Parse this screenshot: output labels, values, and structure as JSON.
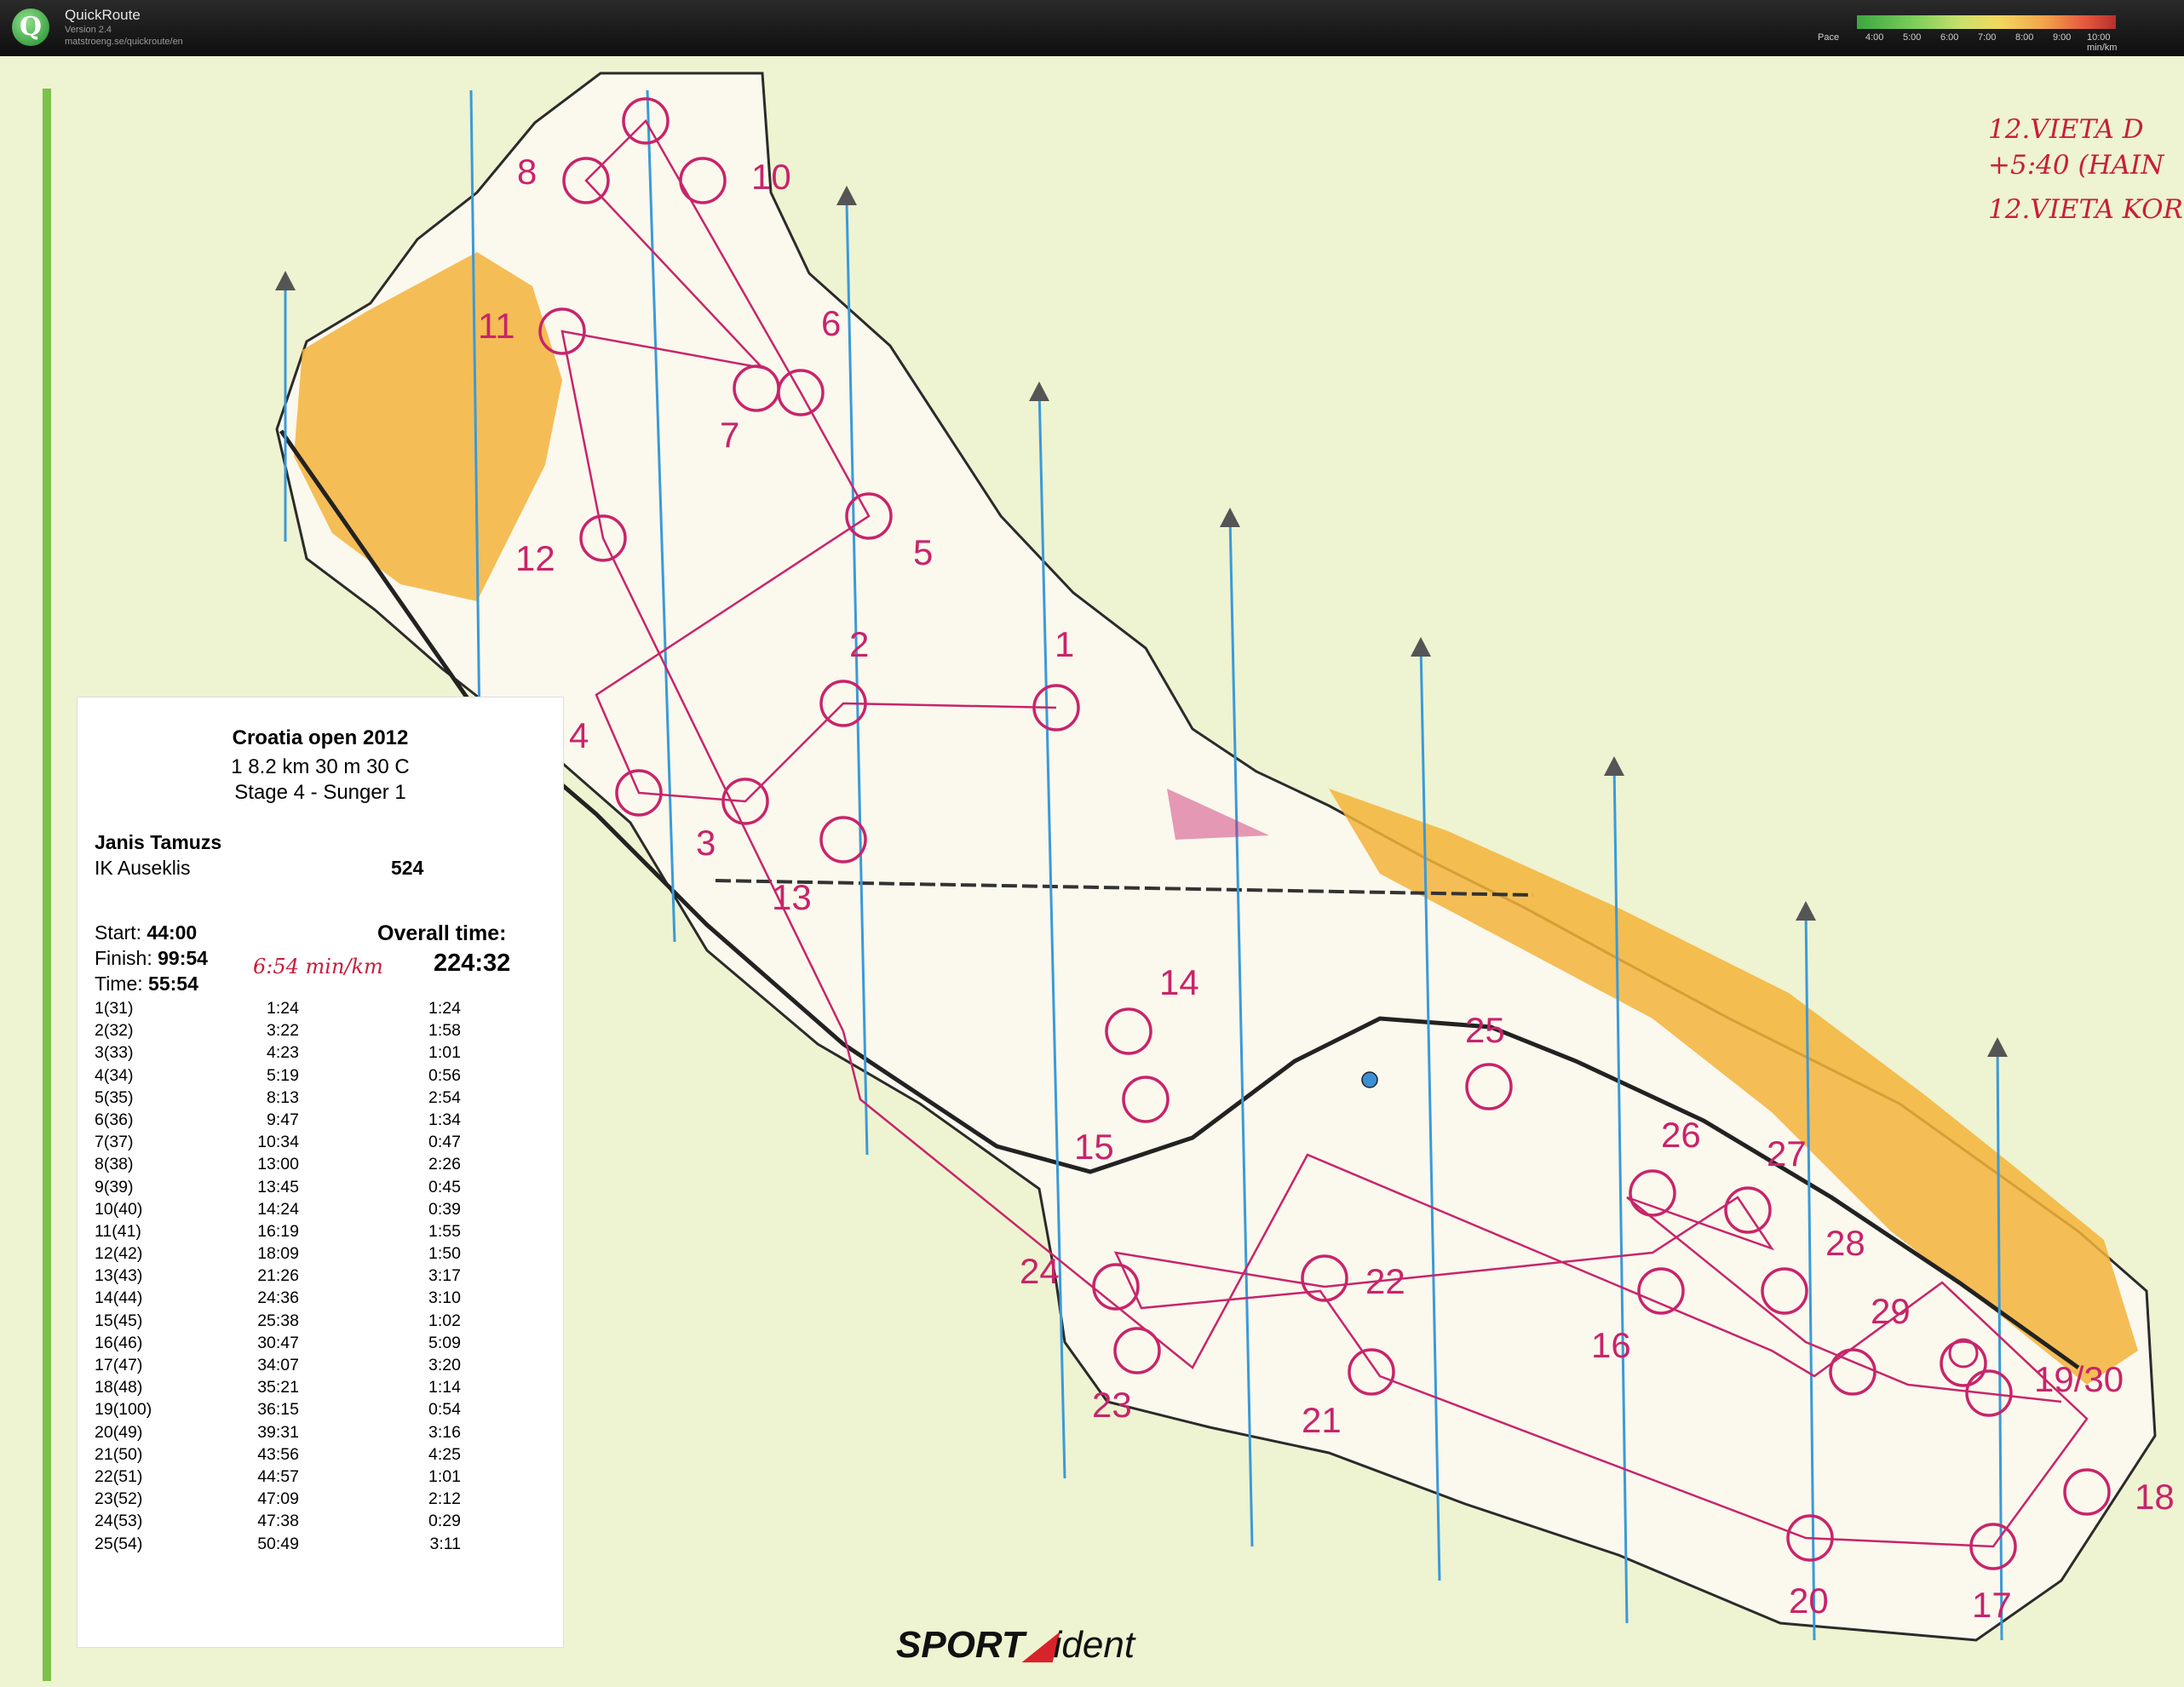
{
  "app": {
    "title": "QuickRoute",
    "version": "Version 2.4",
    "url": "matstroeng.se/quickroute/en",
    "logo_letter": "Q",
    "pace_label": "Pace",
    "pace_ticks": [
      "4:00",
      "5:00",
      "6:00",
      "7:00",
      "8:00",
      "9:00",
      "10:00 min/km"
    ]
  },
  "event": {
    "title": "Croatia open 2012",
    "course": "1  8.2 km  30 m  30 C",
    "stage": "Stage 4 - Sunger 1"
  },
  "runner": {
    "name": "Janis Tamuzs",
    "club": "IK Auseklis",
    "place": "524",
    "start_label": "Start:",
    "start": "44:00",
    "finish_label": "Finish:",
    "finish": "99:54",
    "time_label": "Time:",
    "time": "55:54",
    "overall_label": "Overall time:",
    "overall": "224:32",
    "handwritten_pace": "6:54 min/km"
  },
  "splits": [
    {
      "control": "1(31)",
      "cumulative": "1:24",
      "leg": "1:24"
    },
    {
      "control": "2(32)",
      "cumulative": "3:22",
      "leg": "1:58"
    },
    {
      "control": "3(33)",
      "cumulative": "4:23",
      "leg": "1:01"
    },
    {
      "control": "4(34)",
      "cumulative": "5:19",
      "leg": "0:56"
    },
    {
      "control": "5(35)",
      "cumulative": "8:13",
      "leg": "2:54"
    },
    {
      "control": "6(36)",
      "cumulative": "9:47",
      "leg": "1:34"
    },
    {
      "control": "7(37)",
      "cumulative": "10:34",
      "leg": "0:47"
    },
    {
      "control": "8(38)",
      "cumulative": "13:00",
      "leg": "2:26"
    },
    {
      "control": "9(39)",
      "cumulative": "13:45",
      "leg": "0:45"
    },
    {
      "control": "10(40)",
      "cumulative": "14:24",
      "leg": "0:39"
    },
    {
      "control": "11(41)",
      "cumulative": "16:19",
      "leg": "1:55"
    },
    {
      "control": "12(42)",
      "cumulative": "18:09",
      "leg": "1:50"
    },
    {
      "control": "13(43)",
      "cumulative": "21:26",
      "leg": "3:17"
    },
    {
      "control": "14(44)",
      "cumulative": "24:36",
      "leg": "3:10"
    },
    {
      "control": "15(45)",
      "cumulative": "25:38",
      "leg": "1:02"
    },
    {
      "control": "16(46)",
      "cumulative": "30:47",
      "leg": "5:09"
    },
    {
      "control": "17(47)",
      "cumulative": "34:07",
      "leg": "3:20"
    },
    {
      "control": "18(48)",
      "cumulative": "35:21",
      "leg": "1:14"
    },
    {
      "control": "19(100)",
      "cumulative": "36:15",
      "leg": "0:54"
    },
    {
      "control": "20(49)",
      "cumulative": "39:31",
      "leg": "3:16"
    },
    {
      "control": "21(50)",
      "cumulative": "43:56",
      "leg": "4:25"
    },
    {
      "control": "22(51)",
      "cumulative": "44:57",
      "leg": "1:01"
    },
    {
      "control": "23(52)",
      "cumulative": "47:09",
      "leg": "2:12"
    },
    {
      "control": "24(53)",
      "cumulative": "47:38",
      "leg": "0:29"
    },
    {
      "control": "25(54)",
      "cumulative": "50:49",
      "leg": "3:11"
    }
  ],
  "control_labels": [
    "8",
    "10",
    "11",
    "6",
    "7",
    "12",
    "5",
    "2",
    "1",
    "4",
    "3",
    "13",
    "14",
    "15",
    "25",
    "26",
    "27",
    "28",
    "24",
    "22",
    "16",
    "29",
    "23",
    "21",
    "19/30",
    "18",
    "20",
    "17"
  ],
  "handnotes": [
    "12.VIETA  D",
    "+5:40 (HAIN",
    "12.VIETA  KOR"
  ],
  "sponsor": {
    "sport": "SPORT",
    "ident": "ident"
  },
  "colors": {
    "map_background": "#eef3d1",
    "terrain": "#fbf8ee",
    "open_land": "#f3b33a",
    "course": "#c8246a",
    "pace_bar_low": "#3ca641",
    "pace_bar_high": "#b7302d"
  }
}
